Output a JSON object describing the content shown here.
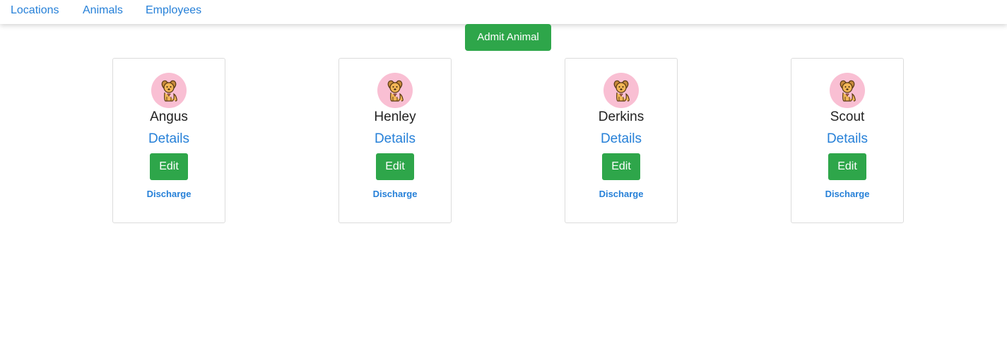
{
  "nav": {
    "items": [
      {
        "label": "Locations"
      },
      {
        "label": "Animals"
      },
      {
        "label": "Employees"
      }
    ]
  },
  "admit_button": {
    "label": "Admit Animal"
  },
  "animals": [
    {
      "name": "Angus",
      "details_label": "Details",
      "edit_label": "Edit",
      "discharge_label": "Discharge",
      "icon": "dog-icon"
    },
    {
      "name": "Henley",
      "details_label": "Details",
      "edit_label": "Edit",
      "discharge_label": "Discharge",
      "icon": "dog-icon"
    },
    {
      "name": "Derkins",
      "details_label": "Details",
      "edit_label": "Edit",
      "discharge_label": "Discharge",
      "icon": "dog-icon"
    },
    {
      "name": "Scout",
      "details_label": "Details",
      "edit_label": "Edit",
      "discharge_label": "Discharge",
      "icon": "dog-icon"
    }
  ],
  "colors": {
    "link": "#2680d8",
    "button": "#2ea64a",
    "avatar_bg": "#f9bfd3",
    "card_border": "#dcdcdc"
  }
}
